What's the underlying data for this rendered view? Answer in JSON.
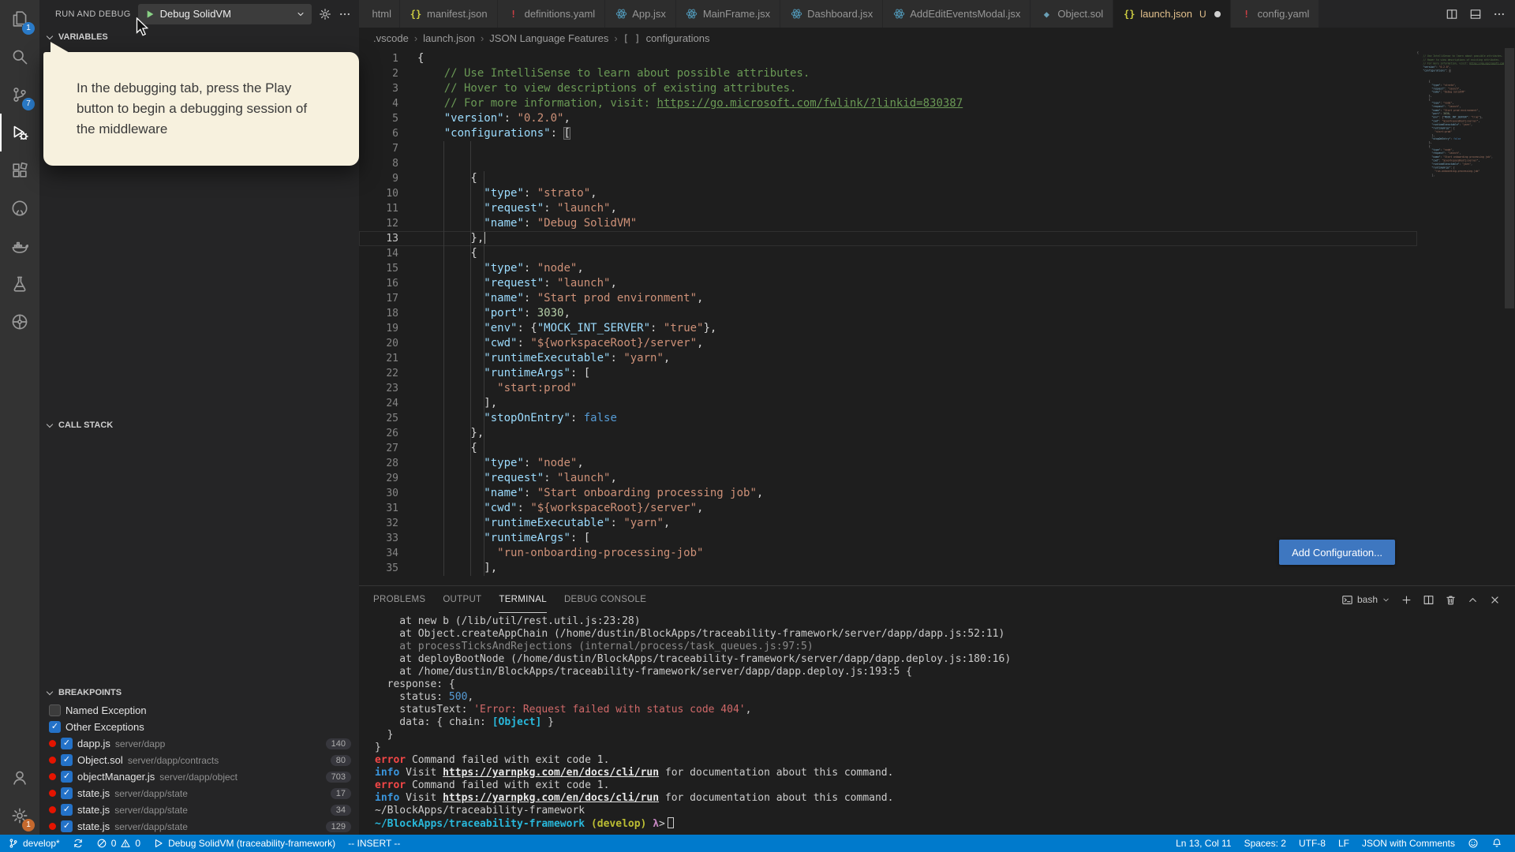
{
  "colors": {
    "statusbar-bg": "#007acc",
    "activity-bg": "#333333",
    "sidebar-bg": "#252526",
    "editor-bg": "#1e1e1e",
    "tabbar-bg": "#252526",
    "tab-inactive": "#2d2d2d",
    "tooltip-bg": "#f7f1de",
    "button-bg": "#3e77c0",
    "badge-blue": "#2a7ac7",
    "badge-orange": "#c5692e",
    "bp-red": "#e51400",
    "check-blue": "#2472c8",
    "git-modified": "#e2c08d",
    "tok-p": "#d4d4d4",
    "tok-k": "#9cdcfe",
    "tok-s": "#ce9178",
    "tok-n": "#b5cea8",
    "tok-b": "#569cd6",
    "tok-c": "#6a9955",
    "tm-d": "#cccccc",
    "tm-dim": "#8a8a8a",
    "tm-num": "#569cd6",
    "tm-red": "#d16969",
    "tm-err": "#f44747",
    "tm-info": "#3a96dd",
    "tm-link": "#e8e8e8",
    "tm-cyan": "#29b8db",
    "tm-yellow": "#bcbe33",
    "tm-magenta": "#c586c0"
  },
  "activity_bar": {
    "top": [
      {
        "name": "explorer",
        "badge": "1"
      },
      {
        "name": "search"
      },
      {
        "name": "source-control",
        "badge": "7"
      },
      {
        "name": "run-and-debug",
        "active": true
      },
      {
        "name": "extensions"
      },
      {
        "name": "github"
      },
      {
        "name": "docker"
      },
      {
        "name": "test-explorer"
      },
      {
        "name": "kubernetes"
      }
    ],
    "bottom": [
      {
        "name": "account"
      },
      {
        "name": "settings",
        "badge": "1",
        "badge_style": "orange"
      }
    ]
  },
  "sidebar": {
    "title": "RUN AND DEBUG",
    "config_name": "Debug SolidVM",
    "sections": {
      "variables": "VARIABLES",
      "call_stack": "CALL STACK",
      "breakpoints": "BREAKPOINTS"
    },
    "breakpoints": [
      {
        "checked": false,
        "dot": false,
        "label": "Named Exception"
      },
      {
        "checked": true,
        "dot": false,
        "label": "Other Exceptions"
      },
      {
        "checked": true,
        "dot": true,
        "label": "dapp.js",
        "path": "server/dapp",
        "line": "140"
      },
      {
        "checked": true,
        "dot": true,
        "label": "Object.sol",
        "path": "server/dapp/contracts",
        "line": "80"
      },
      {
        "checked": true,
        "dot": true,
        "label": "objectManager.js",
        "path": "server/dapp/object",
        "line": "703"
      },
      {
        "checked": true,
        "dot": true,
        "label": "state.js",
        "path": "server/dapp/state",
        "line": "17"
      },
      {
        "checked": true,
        "dot": true,
        "label": "state.js",
        "path": "server/dapp/state",
        "line": "34"
      },
      {
        "checked": true,
        "dot": true,
        "label": "state.js",
        "path": "server/dapp/state",
        "line": "129"
      }
    ]
  },
  "tooltip": {
    "text": "In the debugging tab, press the Play button to begin a debugging session of the middleware"
  },
  "tabs": [
    {
      "label": "html",
      "clipped": true
    },
    {
      "icon": "json",
      "label": "manifest.json"
    },
    {
      "icon": "yaml",
      "label": "definitions.yaml"
    },
    {
      "icon": "react",
      "label": "App.jsx"
    },
    {
      "icon": "react",
      "label": "MainFrame.jsx"
    },
    {
      "icon": "react",
      "label": "Dashboard.jsx"
    },
    {
      "icon": "react",
      "label": "AddEditEventsModal.jsx"
    },
    {
      "icon": "solidity",
      "label": "Object.sol"
    },
    {
      "icon": "json",
      "label": "launch.json",
      "active": true,
      "git_status": "U",
      "modified": true,
      "git_colored": true
    },
    {
      "icon": "yaml",
      "label": "config.yaml"
    }
  ],
  "editor_actions": [
    "split-editor",
    "layout",
    "more"
  ],
  "breadcrumbs": [
    {
      "label": ".vscode"
    },
    {
      "label": "launch.json"
    },
    {
      "label": "JSON Language Features"
    },
    {
      "label": "configurations",
      "prefix": "[ ]"
    }
  ],
  "editor": {
    "cursor_line": 13,
    "add_configuration_label": "Add Configuration...",
    "lines": [
      [
        [
          "p",
          "{"
        ]
      ],
      [
        [
          "c",
          "    // Use IntelliSense to learn about possible attributes."
        ]
      ],
      [
        [
          "c",
          "    // Hover to view descriptions of existing attributes."
        ]
      ],
      [
        [
          "c",
          "    // For more information, visit: "
        ],
        [
          "cl",
          "https://go.microsoft.com/fwlink/?linkid=830387"
        ]
      ],
      [
        [
          "p",
          "    "
        ],
        [
          "k",
          "\"version\""
        ],
        [
          "p",
          ": "
        ],
        [
          "s",
          "\"0.2.0\""
        ],
        [
          "p",
          ","
        ]
      ],
      [
        [
          "p",
          "    "
        ],
        [
          "k",
          "\"configurations\""
        ],
        [
          "p",
          ": "
        ],
        [
          "bm",
          "["
        ]
      ],
      [],
      [],
      [
        [
          "p",
          "        {"
        ]
      ],
      [
        [
          "p",
          "          "
        ],
        [
          "k",
          "\"type\""
        ],
        [
          "p",
          ": "
        ],
        [
          "s",
          "\"strato\""
        ],
        [
          "p",
          ","
        ]
      ],
      [
        [
          "p",
          "          "
        ],
        [
          "k",
          "\"request\""
        ],
        [
          "p",
          ": "
        ],
        [
          "s",
          "\"launch\""
        ],
        [
          "p",
          ","
        ]
      ],
      [
        [
          "p",
          "          "
        ],
        [
          "k",
          "\"name\""
        ],
        [
          "p",
          ": "
        ],
        [
          "s",
          "\"Debug SolidVM\""
        ]
      ],
      [
        [
          "p",
          "        },"
        ]
      ],
      [
        [
          "p",
          "        {"
        ]
      ],
      [
        [
          "p",
          "          "
        ],
        [
          "k",
          "\"type\""
        ],
        [
          "p",
          ": "
        ],
        [
          "s",
          "\"node\""
        ],
        [
          "p",
          ","
        ]
      ],
      [
        [
          "p",
          "          "
        ],
        [
          "k",
          "\"request\""
        ],
        [
          "p",
          ": "
        ],
        [
          "s",
          "\"launch\""
        ],
        [
          "p",
          ","
        ]
      ],
      [
        [
          "p",
          "          "
        ],
        [
          "k",
          "\"name\""
        ],
        [
          "p",
          ": "
        ],
        [
          "s",
          "\"Start prod environment\""
        ],
        [
          "p",
          ","
        ]
      ],
      [
        [
          "p",
          "          "
        ],
        [
          "k",
          "\"port\""
        ],
        [
          "p",
          ": "
        ],
        [
          "n",
          "3030"
        ],
        [
          "p",
          ","
        ]
      ],
      [
        [
          "p",
          "          "
        ],
        [
          "k",
          "\"env\""
        ],
        [
          "p",
          ": {"
        ],
        [
          "k",
          "\"MOCK_INT_SERVER\""
        ],
        [
          "p",
          ": "
        ],
        [
          "s",
          "\"true\""
        ],
        [
          "p",
          "},"
        ]
      ],
      [
        [
          "p",
          "          "
        ],
        [
          "k",
          "\"cwd\""
        ],
        [
          "p",
          ": "
        ],
        [
          "s",
          "\"${workspaceRoot}/server\""
        ],
        [
          "p",
          ","
        ]
      ],
      [
        [
          "p",
          "          "
        ],
        [
          "k",
          "\"runtimeExecutable\""
        ],
        [
          "p",
          ": "
        ],
        [
          "s",
          "\"yarn\""
        ],
        [
          "p",
          ","
        ]
      ],
      [
        [
          "p",
          "          "
        ],
        [
          "k",
          "\"runtimeArgs\""
        ],
        [
          "p",
          ": ["
        ]
      ],
      [
        [
          "p",
          "            "
        ],
        [
          "s",
          "\"start:prod\""
        ]
      ],
      [
        [
          "p",
          "          ],"
        ]
      ],
      [
        [
          "p",
          "          "
        ],
        [
          "k",
          "\"stopOnEntry\""
        ],
        [
          "p",
          ": "
        ],
        [
          "b",
          "false"
        ]
      ],
      [
        [
          "p",
          "        },"
        ]
      ],
      [
        [
          "p",
          "        {"
        ]
      ],
      [
        [
          "p",
          "          "
        ],
        [
          "k",
          "\"type\""
        ],
        [
          "p",
          ": "
        ],
        [
          "s",
          "\"node\""
        ],
        [
          "p",
          ","
        ]
      ],
      [
        [
          "p",
          "          "
        ],
        [
          "k",
          "\"request\""
        ],
        [
          "p",
          ": "
        ],
        [
          "s",
          "\"launch\""
        ],
        [
          "p",
          ","
        ]
      ],
      [
        [
          "p",
          "          "
        ],
        [
          "k",
          "\"name\""
        ],
        [
          "p",
          ": "
        ],
        [
          "s",
          "\"Start onboarding processing job\""
        ],
        [
          "p",
          ","
        ]
      ],
      [
        [
          "p",
          "          "
        ],
        [
          "k",
          "\"cwd\""
        ],
        [
          "p",
          ": "
        ],
        [
          "s",
          "\"${workspaceRoot}/server\""
        ],
        [
          "p",
          ","
        ]
      ],
      [
        [
          "p",
          "          "
        ],
        [
          "k",
          "\"runtimeExecutable\""
        ],
        [
          "p",
          ": "
        ],
        [
          "s",
          "\"yarn\""
        ],
        [
          "p",
          ","
        ]
      ],
      [
        [
          "p",
          "          "
        ],
        [
          "k",
          "\"runtimeArgs\""
        ],
        [
          "p",
          ": ["
        ]
      ],
      [
        [
          "p",
          "            "
        ],
        [
          "s",
          "\"run-onboarding-processing-job\""
        ]
      ],
      [
        [
          "p",
          "          ],"
        ]
      ]
    ]
  },
  "panel": {
    "tabs": [
      "PROBLEMS",
      "OUTPUT",
      "TERMINAL",
      "DEBUG CONSOLE"
    ],
    "active_tab": "TERMINAL",
    "shell": "bash",
    "actions": [
      "add-terminal",
      "split-terminal",
      "kill-terminal",
      "maximize-panel",
      "close-panel"
    ],
    "terminal": [
      [
        [
          "d",
          "    at new b (/lib/util/rest.util.js:23:28)"
        ]
      ],
      [
        [
          "d",
          "    at Object.createAppChain (/home/dustin/BlockApps/traceability-framework/server/dapp/dapp.js:52:11)"
        ]
      ],
      [
        [
          "dim",
          "    at processTicksAndRejections (internal/process/task_queues.js:97:5)"
        ]
      ],
      [
        [
          "d",
          "    at deployBootNode (/home/dustin/BlockApps/traceability-framework/server/dapp/dapp.deploy.js:180:16)"
        ]
      ],
      [
        [
          "d",
          "    at /home/dustin/BlockApps/traceability-framework/server/dapp/dapp.deploy.js:193:5 {"
        ]
      ],
      [
        [
          "d",
          "  response: {"
        ]
      ],
      [
        [
          "d",
          "    status: "
        ],
        [
          "num",
          "500"
        ],
        [
          "d",
          ","
        ]
      ],
      [
        [
          "d",
          "    statusText: "
        ],
        [
          "red",
          "'Error: Request failed with status code 404'"
        ],
        [
          "d",
          ","
        ]
      ],
      [
        [
          "d",
          "    data: { chain: "
        ],
        [
          "cyan",
          "[Object]"
        ],
        [
          "d",
          " }"
        ]
      ],
      [
        [
          "d",
          "  }"
        ]
      ],
      [
        [
          "d",
          "}"
        ]
      ],
      [
        [
          "err",
          "error"
        ],
        [
          "d",
          " Command failed with exit code 1."
        ]
      ],
      [
        [
          "info",
          "info"
        ],
        [
          "d",
          " Visit "
        ],
        [
          "link",
          "https://yarnpkg.com/en/docs/cli/run"
        ],
        [
          "d",
          " for documentation about this command."
        ]
      ],
      [
        [
          "err",
          "error"
        ],
        [
          "d",
          " Command failed with exit code 1."
        ]
      ],
      [
        [
          "info",
          "info"
        ],
        [
          "d",
          " Visit "
        ],
        [
          "link",
          "https://yarnpkg.com/en/docs/cli/run"
        ],
        [
          "d",
          " for documentation about this command."
        ]
      ],
      [
        [
          "d",
          "~/BlockApps/traceability-framework"
        ]
      ],
      [
        [
          "cyan",
          "~/BlockApps/traceability-framework "
        ],
        [
          "yellow",
          "(develop) "
        ],
        [
          "magenta",
          "λ"
        ],
        [
          "d",
          ">"
        ],
        [
          "cursor",
          ""
        ]
      ]
    ]
  },
  "status_bar": {
    "left": [
      {
        "name": "git-branch",
        "parts": [
          [
            "icon",
            "branch"
          ],
          [
            "text",
            "develop*"
          ]
        ]
      },
      {
        "name": "sync",
        "parts": [
          [
            "icon",
            "sync"
          ]
        ]
      },
      {
        "name": "problems",
        "parts": [
          [
            "icon",
            "error"
          ],
          [
            "text",
            "0"
          ],
          [
            "icon",
            "warning"
          ],
          [
            "text",
            "0"
          ]
        ]
      },
      {
        "name": "debug-status",
        "parts": [
          [
            "icon",
            "debug-status"
          ],
          [
            "text",
            "Debug SolidVM (traceability-framework)"
          ]
        ]
      },
      {
        "name": "vim-mode",
        "parts": [
          [
            "text",
            "-- INSERT --"
          ]
        ]
      }
    ],
    "right": [
      {
        "name": "cursor-position",
        "parts": [
          [
            "text",
            "Ln 13, Col 11"
          ]
        ]
      },
      {
        "name": "indentation",
        "parts": [
          [
            "text",
            "Spaces: 2"
          ]
        ]
      },
      {
        "name": "encoding",
        "parts": [
          [
            "text",
            "UTF-8"
          ]
        ]
      },
      {
        "name": "eol",
        "parts": [
          [
            "text",
            "LF"
          ]
        ]
      },
      {
        "name": "language-mode",
        "parts": [
          [
            "text",
            "JSON with Comments"
          ]
        ]
      },
      {
        "name": "feedback",
        "parts": [
          [
            "icon",
            "smiley"
          ]
        ]
      },
      {
        "name": "notifications",
        "parts": [
          [
            "icon",
            "bell"
          ]
        ]
      }
    ]
  }
}
